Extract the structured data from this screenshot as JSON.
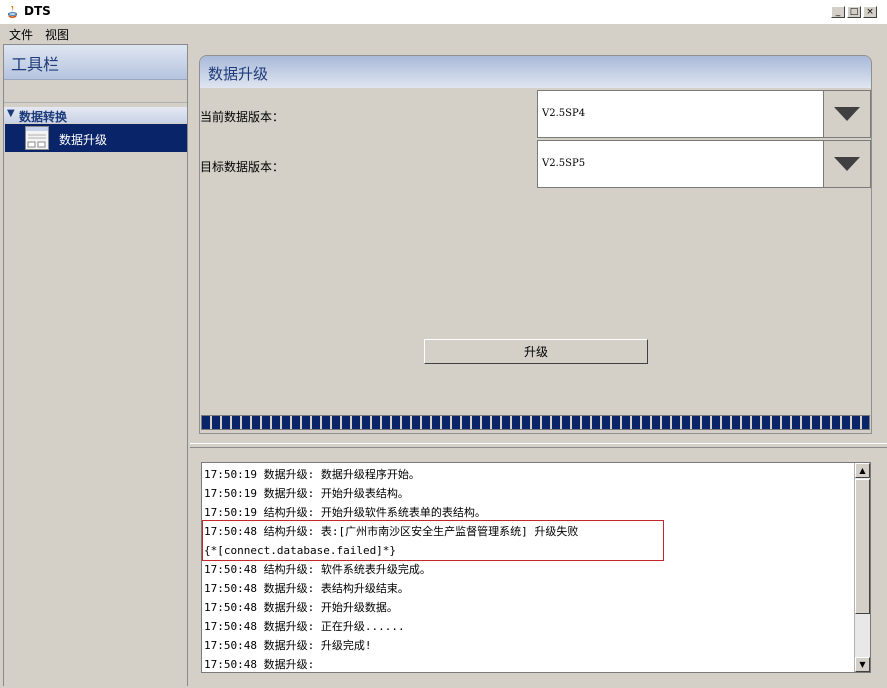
{
  "window": {
    "title": "DTS",
    "minimize": "_",
    "maximize": "□",
    "close": "×"
  },
  "menu": {
    "items": [
      "文件",
      "视图"
    ]
  },
  "sidebar": {
    "title": "工具栏",
    "group": {
      "label": "数据转换",
      "icon": "triangle-down-icon"
    },
    "items": [
      {
        "label": "数据升级",
        "icon": "window-icon",
        "selected": true
      }
    ]
  },
  "main": {
    "header": "数据升级",
    "current_version": {
      "label": "当前数据版本：",
      "value": "V2.5SP4"
    },
    "target_version": {
      "label": "目标数据版本：",
      "value": "V2.5SP5"
    },
    "upgrade_button": "升级",
    "progress": 1.0,
    "colors": {
      "selection": "#0a246a",
      "highlight_border": "#c0282d",
      "header": "#a9b9d9"
    }
  },
  "log": {
    "lines": [
      "17:50:19 数据升级: 数据升级程序开始。",
      "17:50:19 数据升级: 开始升级表结构。",
      "17:50:19 结构升级: 开始升级软件系统表单的表结构。",
      "17:50:48 结构升级: 表:[广州市南沙区安全生产监督管理系统] 升级失败",
      "{*[connect.database.failed]*}",
      "17:50:48 结构升级: 软件系统表升级完成。",
      "17:50:48 数据升级: 表结构升级结束。",
      "17:50:48 数据升级: 开始升级数据。",
      "17:50:48 数据升级: 正在升级......",
      "17:50:48 数据升级: 升级完成!",
      "17:50:48 数据升级:"
    ]
  }
}
